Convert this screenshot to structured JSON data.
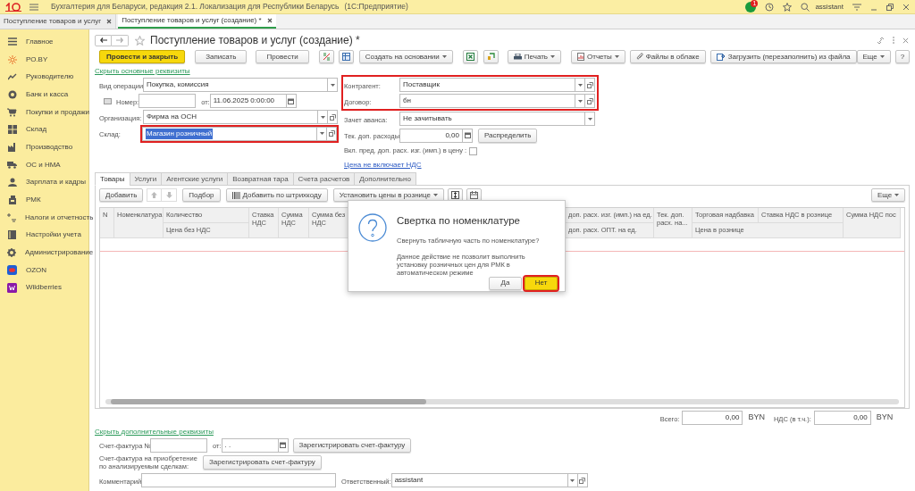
{
  "app_bar": {
    "title": "Бухгалтерия для Беларуси, редакция 2.1. Локализация для Республики Беларусь",
    "platform": "(1С:Предприятие)",
    "notifications": "1",
    "user": "assistant"
  },
  "open_tabs": [
    {
      "label": "Поступление товаров и услуг",
      "selected": false
    },
    {
      "label": "Поступление товаров и услуг (создание) *",
      "selected": true
    }
  ],
  "sidebar": {
    "items": [
      {
        "label": "Главное"
      },
      {
        "label": "РО.BY"
      },
      {
        "label": "Руководителю"
      },
      {
        "label": "Банк и касса"
      },
      {
        "label": "Покупки и продажи"
      },
      {
        "label": "Склад"
      },
      {
        "label": "Производство"
      },
      {
        "label": "ОС и НМА"
      },
      {
        "label": "Зарплата и кадры"
      },
      {
        "label": "РМК"
      },
      {
        "label": "Налоги и отчетность"
      },
      {
        "label": "Настройки учета"
      },
      {
        "label": "Администрирование"
      },
      {
        "label": "OZON"
      },
      {
        "label": "Wildberries"
      }
    ]
  },
  "document": {
    "title": "Поступление товаров и услуг (создание) *",
    "toolbar": [
      {
        "kind": "primary",
        "label": "Провести и закрыть"
      },
      {
        "kind": "button",
        "label": "Записать"
      },
      {
        "kind": "button",
        "label": "Провести"
      },
      {
        "kind": "icon"
      },
      {
        "kind": "icon"
      },
      {
        "kind": "menu",
        "label": "Создать на основании"
      },
      {
        "kind": "icon"
      },
      {
        "kind": "icon"
      },
      {
        "kind": "menu",
        "label": "Печать"
      },
      {
        "kind": "menu",
        "label": "Отчеты"
      },
      {
        "kind": "button",
        "label": "Файлы в облаке"
      },
      {
        "kind": "button",
        "label": "Загрузить (перезаполнить) из файла"
      }
    ],
    "more_button": "Еще",
    "help_button": "?",
    "hide_main_link": "Скрыть основные реквизиты",
    "operation": {
      "label": "Вид операции:",
      "value": "Покупка, комиссия"
    },
    "number": {
      "label": "Номер:"
    },
    "date": {
      "label": "от:",
      "value": "11.06.2025  0:00:00"
    },
    "organization": {
      "label": "Организация:",
      "value": "Фирма на ОСН"
    },
    "warehouse": {
      "label": "Склад:",
      "value": "Магазин розничный",
      "highlighted": true,
      "value_selected": true
    },
    "counterparty_block": {
      "highlighted": true,
      "rows": [
        {
          "label": "Контрагент:",
          "value": "Поставщик"
        },
        {
          "label": "Договор:",
          "value": "бн"
        }
      ]
    },
    "advance": {
      "label": "Зачет аванса:",
      "value": "Не зачитывать"
    },
    "extra_costs": {
      "label": "Тек. доп. расходы:",
      "value": "0,00",
      "button": "Распределить"
    },
    "include_costs": {
      "label": "Вкл. пред. доп. расх. изг. (имп.) в цену :",
      "checked": false
    },
    "vat_link": "Цена не включает НДС",
    "tabs": [
      {
        "label": "Товары",
        "selected": true
      },
      {
        "label": "Услуги",
        "selected": false
      },
      {
        "label": "Агентские услуги",
        "selected": false
      },
      {
        "label": "Возвратная тара",
        "selected": false
      },
      {
        "label": "Счета расчетов",
        "selected": false
      },
      {
        "label": "Дополнительно",
        "selected": false
      }
    ],
    "table_toolbar": [
      {
        "kind": "button",
        "label": "Добавить"
      },
      {
        "kind": "arrows"
      },
      {
        "kind": "button",
        "label": "Подбор"
      },
      {
        "kind": "icon_button",
        "label": "Добавить по штрихкоду"
      },
      {
        "kind": "menu",
        "label": "Установить цены в рознице"
      },
      {
        "kind": "icon"
      },
      {
        "kind": "icon"
      }
    ],
    "table_more": "Еще",
    "table": {
      "columns": [
        {
          "kind": "single",
          "top": "N"
        },
        {
          "kind": "single",
          "top": "Номенклатура"
        },
        {
          "kind": "double",
          "top": "Количество",
          "bottom": "Цена без НДС"
        },
        {
          "kind": "single",
          "top": "Ставка НДС"
        },
        {
          "kind": "single",
          "top": "Сумма НДС"
        },
        {
          "kind": "single",
          "top": "Сумма без НДС"
        },
        {
          "kind": "double",
          "top": "доп. расх. изг. (имп.) на ед.",
          "bottom": "доп. расх. ОПТ. на ед."
        },
        {
          "kind": "single",
          "top": "Тек. доп. расх. на..."
        },
        {
          "kind": "double",
          "top": "Торговая надбавка",
          "bottom": "Цена в рознице"
        },
        {
          "kind": "top",
          "top": "Ставка НДС в рознице"
        },
        {
          "kind": "single",
          "top": "Сумма НДС пос"
        }
      ]
    },
    "totals": [
      {
        "label": "Всего:",
        "value": "0,00",
        "currency": "BYN"
      },
      {
        "label": "НДС (в т.ч.):",
        "value": "0,00",
        "currency": "BYN"
      }
    ],
    "hide_extra_link": "Скрыть дополнительные реквизиты",
    "invoice": {
      "label": "Счет-фактура №:",
      "date_label": "от:",
      "date_value": ". .",
      "button": "Зарегистрировать счет-фактуру"
    },
    "invoice_analyzed": {
      "label": "Счет-фактура на приобретение по анализируемым сделкам:",
      "button": "Зарегистрировать счет-фактуру"
    },
    "comment": {
      "label": "Комментарий:"
    },
    "responsible": {
      "label": "Ответственный:",
      "value": "assistant"
    }
  },
  "dialog": {
    "title": "Свертка по номенклатуре",
    "question": "Свернуть табличную часть по номенклатуре?",
    "note": "Данное действие не позволит выполнить установку розничных цен для РМК в автоматическом режиме",
    "buttons": [
      {
        "label": "Да",
        "default": false,
        "highlighted": false
      },
      {
        "label": "Нет",
        "default": true,
        "highlighted": true
      }
    ]
  }
}
